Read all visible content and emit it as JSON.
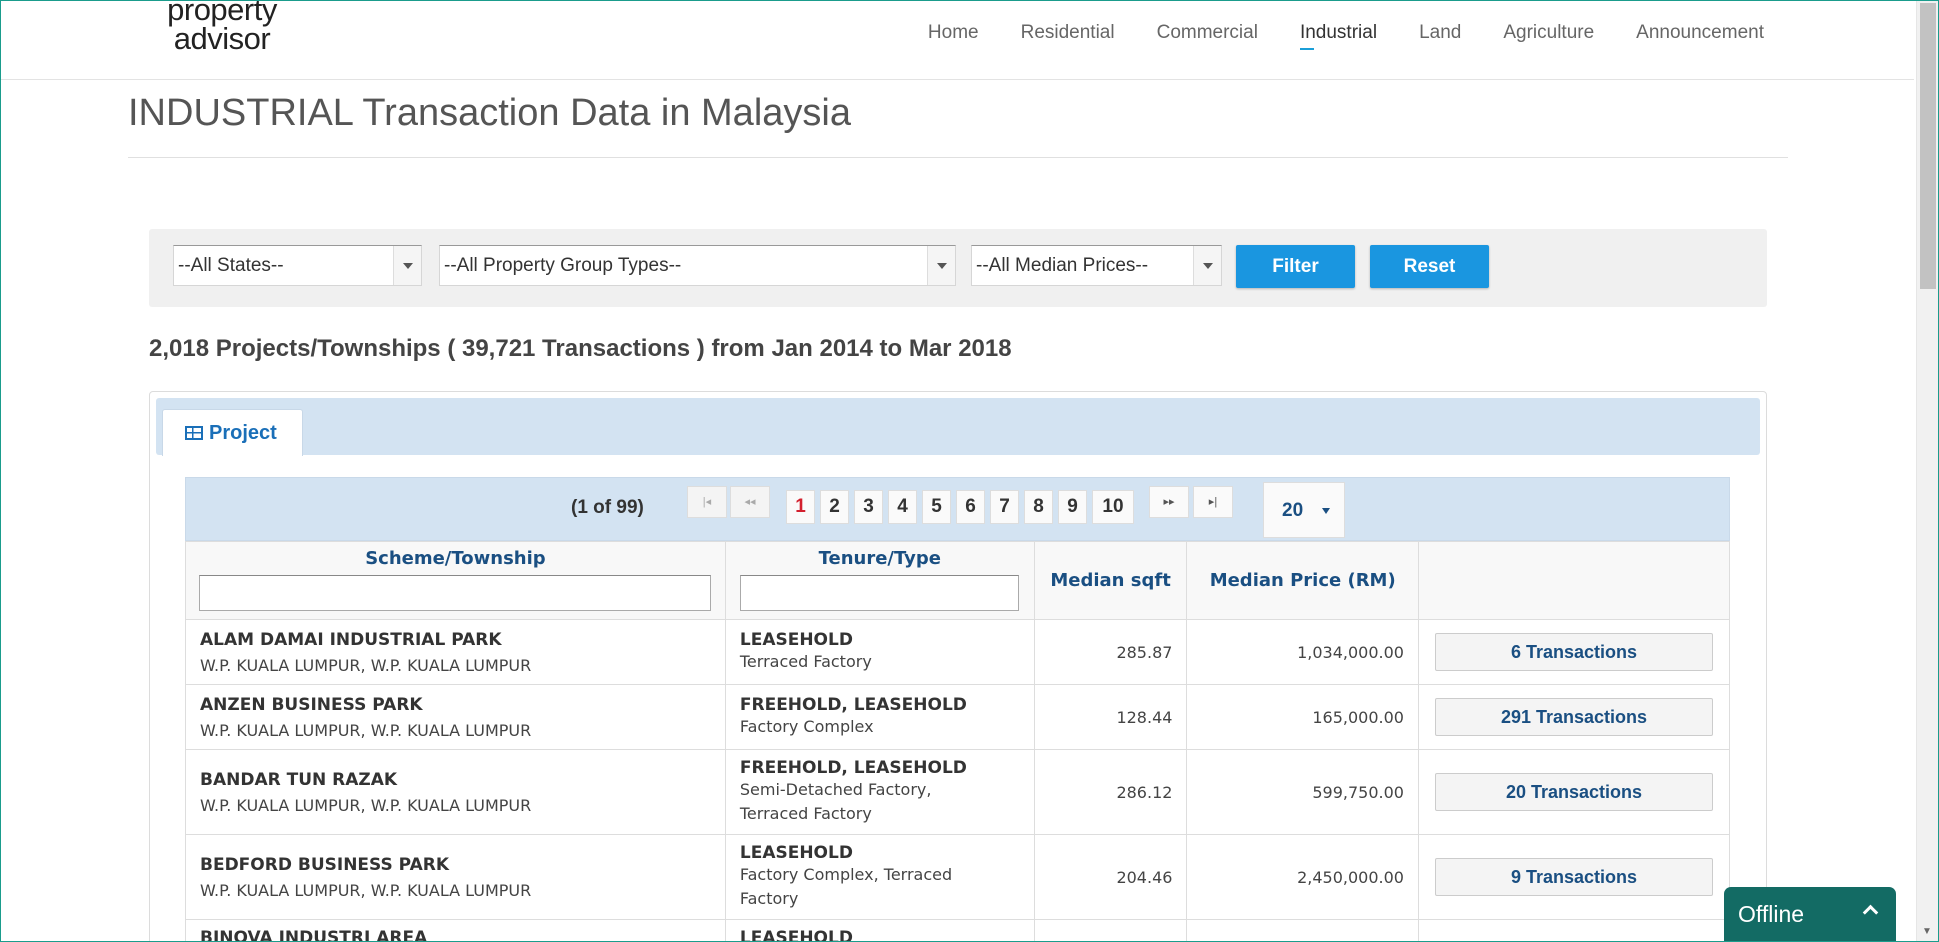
{
  "logo": {
    "line1": "property",
    "line2": "advisor"
  },
  "nav": [
    {
      "label": "Home"
    },
    {
      "label": "Residential"
    },
    {
      "label": "Commercial"
    },
    {
      "label": "Industrial",
      "active": true
    },
    {
      "label": "Land"
    },
    {
      "label": "Agriculture"
    },
    {
      "label": "Announcement"
    }
  ],
  "page_title": "INDUSTRIAL Transaction Data in Malaysia",
  "filters": {
    "states": "--All States--",
    "group_types": "--All Property Group Types--",
    "median_prices": "--All Median Prices--",
    "filter_label": "Filter",
    "reset_label": "Reset"
  },
  "summary": "2,018 Projects/Townships ( 39,721 Transactions ) from Jan 2014 to Mar 2018",
  "tab": {
    "label": "Project"
  },
  "paginator": {
    "info": "(1 of 99)",
    "first": "|◂",
    "prev": "◂◂",
    "pages": [
      "1",
      "2",
      "3",
      "4",
      "5",
      "6",
      "7",
      "8",
      "9",
      "10"
    ],
    "current": "1",
    "next": "▸▸",
    "last": "▸|",
    "rows_per_page": "20"
  },
  "table": {
    "headers": {
      "scheme": "Scheme/Township",
      "tenure": "Tenure/Type",
      "median_sqft": "Median sqft",
      "median_price": "Median Price (RM)"
    },
    "rows": [
      {
        "name": "ALAM DAMAI INDUSTRIAL PARK",
        "location": "W.P. KUALA LUMPUR, W.P. KUALA LUMPUR",
        "tenure": "LEASEHOLD",
        "type_lines": [
          "Terraced Factory"
        ],
        "sqft": "285.87",
        "price": "1,034,000.00",
        "transactions": "6 Transactions"
      },
      {
        "name": "ANZEN BUSINESS PARK",
        "location": "W.P. KUALA LUMPUR, W.P. KUALA LUMPUR",
        "tenure": "FREEHOLD, LEASEHOLD",
        "type_lines": [
          "Factory Complex"
        ],
        "sqft": "128.44",
        "price": "165,000.00",
        "transactions": "291 Transactions"
      },
      {
        "name": "BANDAR TUN RAZAK",
        "location": "W.P. KUALA LUMPUR, W.P. KUALA LUMPUR",
        "tenure": "FREEHOLD, LEASEHOLD",
        "type_lines": [
          "Semi-Detached Factory,",
          "Terraced Factory"
        ],
        "sqft": "286.12",
        "price": "599,750.00",
        "transactions": "20 Transactions"
      },
      {
        "name": "BEDFORD BUSINESS PARK",
        "location": "W.P. KUALA LUMPUR, W.P. KUALA LUMPUR",
        "tenure": "LEASEHOLD",
        "type_lines": [
          "Factory Complex, Terraced",
          "Factory"
        ],
        "sqft": "204.46",
        "price": "2,450,000.00",
        "transactions": "9 Transactions"
      },
      {
        "name": "BINOVA INDUSTRI AREA",
        "location": "",
        "tenure": "LEASEHOLD",
        "type_lines": [],
        "sqft": "",
        "price": "",
        "transactions": ""
      }
    ]
  },
  "offline_chat": {
    "label": "Offline"
  }
}
